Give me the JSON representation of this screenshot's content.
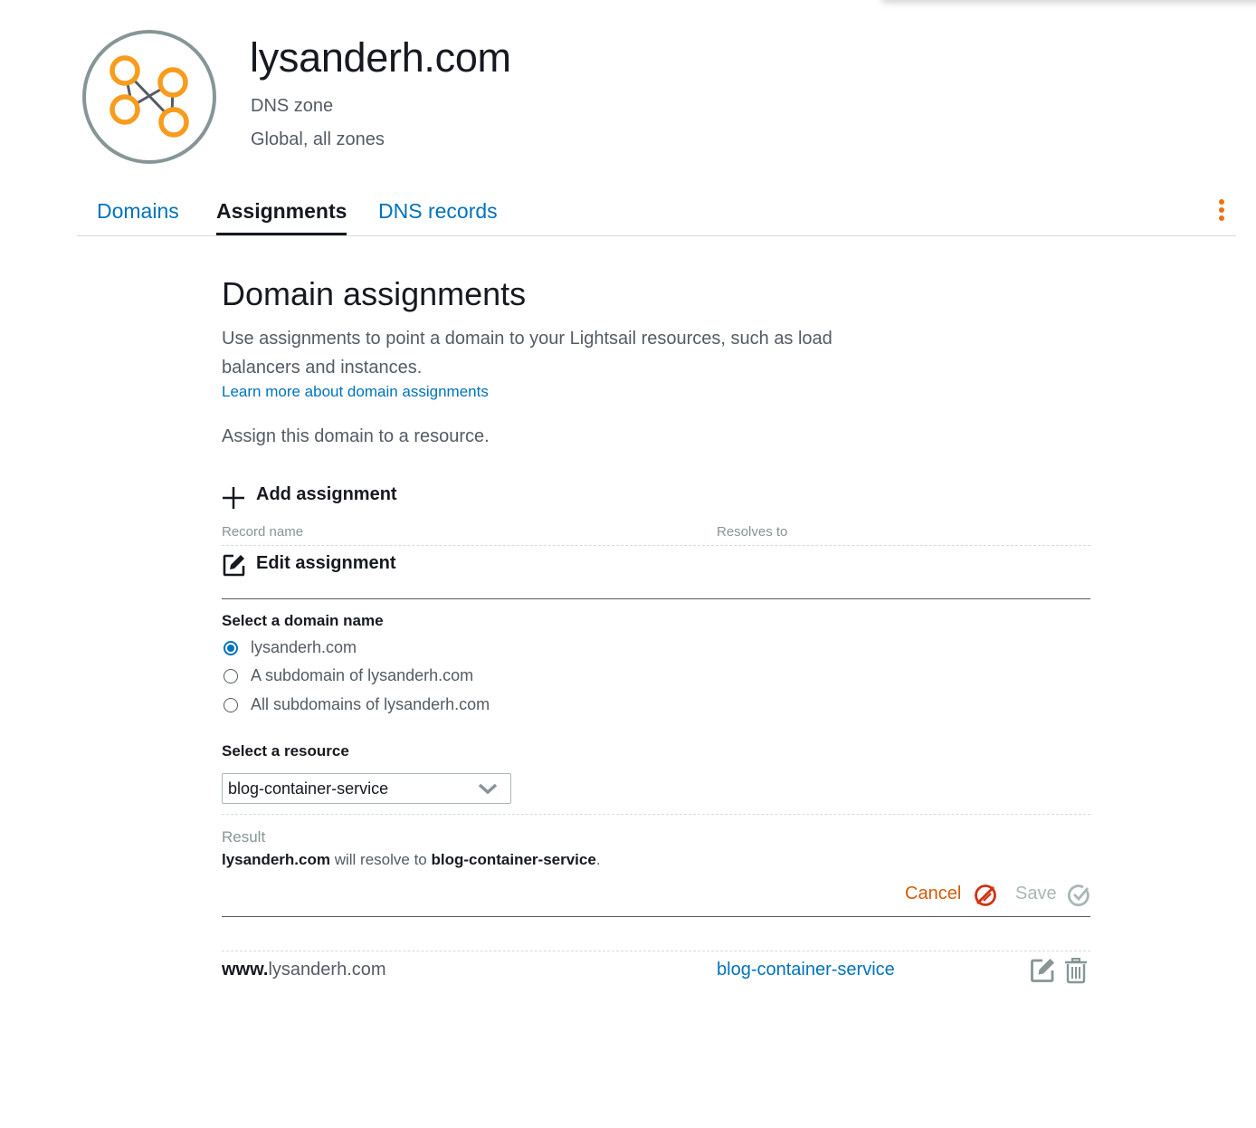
{
  "header": {
    "title": "lysanderh.com",
    "subtitle": "DNS zone",
    "location": "Global, all zones",
    "icon": "dns-zone-icon"
  },
  "tabs": [
    {
      "label": "Domains",
      "active": false
    },
    {
      "label": "Assignments",
      "active": true
    },
    {
      "label": "DNS records",
      "active": false
    }
  ],
  "content": {
    "heading": "Domain assignments",
    "description": "Use assignments to point a domain to your Lightsail resources, such as load balancers and instances.",
    "learn_more": "Learn more about domain assignments",
    "assign_text": "Assign this domain to a resource.",
    "add_assignment": "Add assignment",
    "columns": {
      "record_name": "Record name",
      "resolves_to": "Resolves to"
    },
    "edit_assignment": "Edit assignment",
    "select_domain_label": "Select a domain name",
    "domain_options": [
      {
        "label": "lysanderh.com",
        "selected": true
      },
      {
        "label": "A subdomain of lysanderh.com",
        "selected": false
      },
      {
        "label": "All subdomains of lysanderh.com",
        "selected": false
      }
    ],
    "select_resource_label": "Select a resource",
    "selected_resource": "blog-container-service",
    "result_label": "Result",
    "result": {
      "domain": "lysanderh.com",
      "middle": " will resolve to ",
      "target": "blog-container-service",
      "end": "."
    },
    "cancel_label": "Cancel",
    "save_label": "Save",
    "assignments": [
      {
        "prefix": "www.",
        "domain": "lysanderh.com",
        "resolves_to": "blog-container-service"
      }
    ]
  },
  "colors": {
    "accent_orange": "#ec7211",
    "link_blue": "#0073bb",
    "cancel_orange": "#d45b07",
    "cancel_icon_red": "#d13212"
  }
}
